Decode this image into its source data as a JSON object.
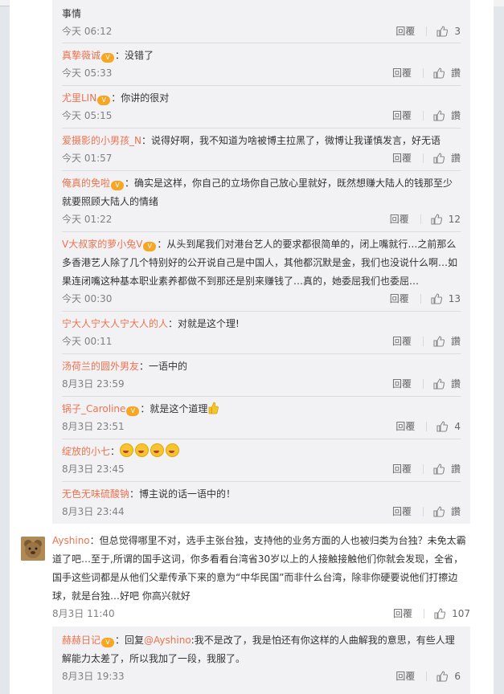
{
  "replies_top": [
    {
      "user": "",
      "text": "事情",
      "time": "今天 06:12",
      "reply_label": "回覆",
      "likes": "3"
    },
    {
      "user": "真摯薇诚",
      "text": "：没错了",
      "time": "今天 05:33",
      "reply_label": "回覆",
      "likes": "讚"
    },
    {
      "user": "尤里LIN",
      "text": "：你讲的很对",
      "time": "今天 05:15",
      "reply_label": "回覆",
      "likes": "讚"
    },
    {
      "user": "爱摄影的小男孩_N",
      "text": "：说得好啊，我不知道为啥被博主拉黑了，微博让我谨慎发言，好无语",
      "time": "今天 01:57",
      "reply_label": "回覆",
      "likes": "讚"
    },
    {
      "user": "俺真的免啦",
      "text": "：确实是这样，你自己的立场你自己放心里就好，既然想赚大陆人的钱那至少就要照顾大陆人的情绪",
      "time": "今天 01:22",
      "reply_label": "回覆",
      "likes": "12"
    },
    {
      "user": "V大叔家的萝小兔V",
      "text": "：从头到尾我们对港台艺人的要求都很简单的，闭上嘴就行…之前那么多香港艺人除了几个特别好的公开说自己是中国人，其他都沉默是金，我们也没说什么啊…如果连闭嘴这种基本职业素养都做不到那还是别来赚钱了…真的，她委屈我们也委屈…",
      "time": "今天 00:30",
      "reply_label": "回覆",
      "likes": "13"
    },
    {
      "user": "宁大人宁大人宁大人的人",
      "text": "：对就是这个理!",
      "time": "今天 00:11",
      "reply_label": "回覆",
      "likes": "讚"
    },
    {
      "user": "汤荷兰的圆外男友",
      "text": "：一语中的",
      "time": "8月3日 23:59",
      "reply_label": "回覆",
      "likes": "讚"
    },
    {
      "user": "锅子_Caroline",
      "text": "：就是这个道理",
      "time": "8月3日 23:51",
      "reply_label": "回覆",
      "likes": "4"
    },
    {
      "user": "绽放的小七",
      "text": "：",
      "time": "8月3日 23:45",
      "reply_label": "回覆",
      "likes": "讚"
    },
    {
      "user": "无色无味硫酸钠",
      "text": "：博主说的话一语中的！",
      "time": "8月3日 23:44",
      "reply_label": "回覆",
      "likes": "讚"
    }
  ],
  "main_comment": {
    "user": "Ayshino",
    "text": "：但总觉得哪里不对，选手主张台独，支持他的业务方面的人也被归类为台独？未免太霸道了吧…至于,所谓的国手这词，你多看看台湾省30岁以上的人接触接触他们你就会发现，全省，国手这些词都是从他们父辈传承下来的意为“中华民国”而非什么台湾，除非你硬要说他们打擦边球，就是台独…好吧 你高兴就好",
    "time": "8月3日 11:40",
    "reply_label": "回覆",
    "likes": "107"
  },
  "sub_reply": {
    "user": "赫赫日记",
    "prefix": "：回复",
    "mention": "@Ayshino",
    "text": ":我不是改了，我是怕还有你这样的人曲解我的意思，有些人理解能力太差了，所以我加了一段，我服了。",
    "time": "8月3日 19:33",
    "reply_label": "回覆",
    "likes": "6"
  },
  "colors": {
    "username": "#eb7350",
    "background": "#e3e6ea",
    "panel": "#f2f2f5"
  }
}
